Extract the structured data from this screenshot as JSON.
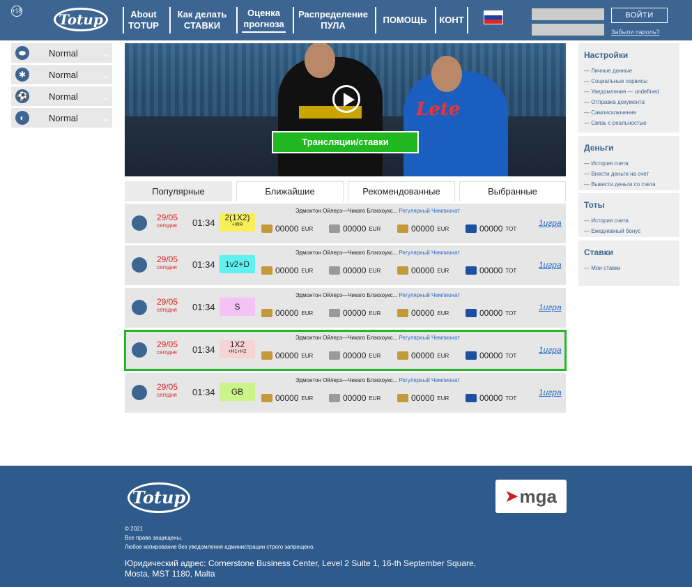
{
  "header": {
    "age_badge": "+18",
    "logo": "Totup",
    "nav": [
      {
        "label": "About TOTUP"
      },
      {
        "label": "Как делать СТАВКИ"
      },
      {
        "label": "Оценка прогноза"
      },
      {
        "label": "Распределение ПУЛА"
      },
      {
        "label": "ПОМОЩЬ"
      },
      {
        "label": "КОНТ"
      }
    ],
    "login_label": "ВОЙТИ",
    "forgot_label": "Забыли пароль?"
  },
  "sports": [
    {
      "icon": "rugby-ball-icon",
      "label": "Normal"
    },
    {
      "icon": "basketball-icon",
      "label": "Normal"
    },
    {
      "icon": "soccer-ball-icon",
      "label": "Normal"
    },
    {
      "icon": "volleyball-icon",
      "label": "Normal"
    }
  ],
  "banner": {
    "cta": "Трансляции/ставки",
    "sponsor": "Lete"
  },
  "tabs": [
    "Популярные",
    "Ближайшие",
    "Рекомендованные",
    "Выбранные"
  ],
  "rows": [
    {
      "date": "29/05",
      "day": "сегодня",
      "time": "01:34",
      "bet": "2(1X2)",
      "bet_sub": "+WR",
      "bet_color": "#f8ef58",
      "teams": "Эдмонтон Ойлерз—Чикаго Блэкхоукс...",
      "league": "Регулярный Чемпионат",
      "amounts": [
        {
          "value": "00000",
          "cur": "EUR"
        },
        {
          "value": "00000",
          "cur": "EUR"
        },
        {
          "value": "00000",
          "cur": "EUR"
        },
        {
          "value": "00000",
          "cur": "TOT"
        }
      ],
      "link": "1игра",
      "selected": false
    },
    {
      "date": "29/05",
      "day": "сегодня",
      "time": "01:34",
      "bet": "1v2+D",
      "bet_sub": "",
      "bet_color": "#5ff0f0",
      "teams": "Эдмонтон Ойлерз—Чикаго Блэкхоукс...",
      "league": "Регулярный Чемпионат",
      "amounts": [
        {
          "value": "00000",
          "cur": "EUR"
        },
        {
          "value": "00000",
          "cur": "EUR"
        },
        {
          "value": "00000",
          "cur": "EUR"
        },
        {
          "value": "00000",
          "cur": "TOT"
        }
      ],
      "link": "1игра",
      "selected": false
    },
    {
      "date": "29/05",
      "day": "сегодня",
      "time": "01:34",
      "bet": "S",
      "bet_sub": "",
      "bet_color": "#f4c2f4",
      "teams": "Эдмонтон Ойлерз—Чикаго Блэкхоукс...",
      "league": "Регулярный Чемпионат",
      "amounts": [
        {
          "value": "00000",
          "cur": "EUR"
        },
        {
          "value": "00000",
          "cur": "EUR"
        },
        {
          "value": "00000",
          "cur": "EUR"
        },
        {
          "value": "00000",
          "cur": "TOT"
        }
      ],
      "link": "1игра",
      "selected": false
    },
    {
      "date": "29/05",
      "day": "сегодня",
      "time": "01:34",
      "bet": "1X2",
      "bet_sub": "+H1+H2",
      "bet_color": "#f6d4d4",
      "teams": "Эдмонтон Ойлерз—Чикаго Блэкхоукс...",
      "league": "Регулярный Чемпионат",
      "amounts": [
        {
          "value": "00000",
          "cur": "EUR"
        },
        {
          "value": "00000",
          "cur": "EUR"
        },
        {
          "value": "00000",
          "cur": "EUR"
        },
        {
          "value": "00000",
          "cur": "TOT"
        }
      ],
      "link": "1игра",
      "selected": true
    },
    {
      "date": "29/05",
      "day": "сегодня",
      "time": "01:34",
      "bet": "GB",
      "bet_sub": "",
      "bet_color": "#cbf58a",
      "teams": "Эдмонтон Ойлерз—Чикаго Блэкхоукс...",
      "league": "Регулярный Чемпионат",
      "amounts": [
        {
          "value": "00000",
          "cur": "EUR"
        },
        {
          "value": "00000",
          "cur": "EUR"
        },
        {
          "value": "00000",
          "cur": "EUR"
        },
        {
          "value": "00000",
          "cur": "TOT"
        }
      ],
      "link": "1игра",
      "selected": false
    }
  ],
  "side_menu": [
    {
      "title": "Настройки",
      "items": [
        "— Личные данные",
        "— Социальные сервисы",
        "— Уведомления — undefined",
        "— Отправка документа",
        "— Самоисключение",
        "— Связь с реальностью"
      ]
    },
    {
      "title": "Деньги",
      "items": [
        "— История счета",
        "— Внести деньги на счет",
        "— Вывести деньги со счета"
      ]
    },
    {
      "title": "Тоты",
      "items": [
        "— История счета",
        "— Ежедневный бонус"
      ]
    },
    {
      "title": "Ставки",
      "items": [
        "— Мои ставки"
      ]
    }
  ],
  "footer": {
    "logo": "Totup",
    "copyright": "© 2021",
    "rights": "Все права защищены.",
    "notice": "Любое копирование без уведомления администрации строго запрещено.",
    "address": "Юридический адрес: Cornerstone Business Center, Level 2 Suite 1, 16-th September Square, Mosta, MST 1180, Malta",
    "mga": "mga"
  },
  "colors": {
    "brand": "#3d6592",
    "accent": "#1fb91f",
    "date": "#dd2222",
    "link": "#2a6ac8"
  }
}
